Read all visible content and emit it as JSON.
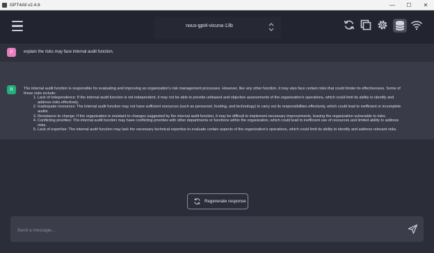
{
  "window": {
    "title": "GPT4All v2.4.6",
    "controls": {
      "minimize": "—",
      "maximize": "☐",
      "close": "✕"
    }
  },
  "toolbar": {
    "model_name": "nous-gpt4-vicuna-13b"
  },
  "conversation": {
    "user": {
      "avatar_letter": "P",
      "text": "explain the risks may face internal audit function."
    },
    "assistant": {
      "avatar_letter": "R",
      "intro": "The internal audit function is responsible for evaluating and improving an organization's risk management processes. However, like any other function, it may also face certain risks that could hinder its effectiveness. Some of these risks include:",
      "items": [
        "Lack of independence: If the internal audit function is not independent, it may not be able to provide unbiased and objective assessments of the organization's operations, which could limit its ability to identify and address risks effectively.",
        "Inadequate resources: The internal audit function may not have sufficient resources (such as personnel, funding, and technology) to carry out its responsibilities effectively, which could lead to inefficient or incomplete audits.",
        "Resistance to change: If the organization is resistant to changes suggested by the internal audit function, it may be difficult to implement necessary improvements, leaving the organization vulnerable to risks.",
        "Conflicting priorities: The internal audit function may have conflicting priorities with other departments or functions within the organization, which could lead to inefficient use of resources and limited ability to address risks.",
        "Lack of expertise: The internal audit function may lack the necessary technical expertise to evaluate certain aspects of the organization's operations, which could limit its ability to identify and address relevant risks."
      ]
    }
  },
  "regenerate": {
    "label": "Regenerate response"
  },
  "input": {
    "placeholder": "Send a message...",
    "value": ""
  },
  "colors": {
    "background": "#2b2d39",
    "toolbar": "#22242f",
    "assistant_row": "#393b48",
    "user_avatar": "#e87ebe",
    "assistant_avatar": "#22b07b"
  },
  "icons": [
    "menu-icon",
    "chevron-updown-icon",
    "reset-icon",
    "copy-icon",
    "settings-icon",
    "database-icon",
    "wifi-icon",
    "regenerate-icon",
    "send-icon"
  ]
}
